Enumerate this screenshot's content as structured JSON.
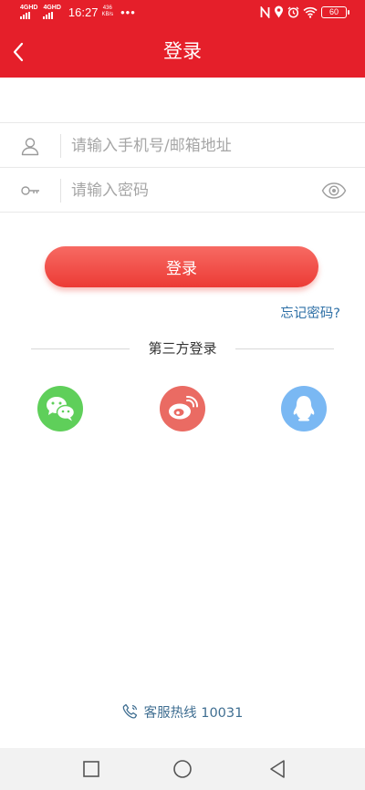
{
  "status_bar": {
    "network1": "4GHD",
    "network2": "4GHD",
    "time": "16:27",
    "speed_value": "436",
    "speed_unit": "KB/s",
    "dots": "•••",
    "battery": "60"
  },
  "header": {
    "title": "登录",
    "back_icon": "chevron-left-icon"
  },
  "form": {
    "account": {
      "icon": "user-icon",
      "placeholder": "请输入手机号/邮箱地址",
      "value": ""
    },
    "password": {
      "icon": "key-icon",
      "placeholder": "请输入密码",
      "value": "",
      "toggle_icon": "eye-icon"
    }
  },
  "login_button": "登录",
  "forgot_password": "忘记密码?",
  "third_party": {
    "label": "第三方登录",
    "providers": [
      {
        "name": "wechat",
        "icon": "wechat-icon",
        "color": "#5fcf5a"
      },
      {
        "name": "weibo",
        "icon": "weibo-icon",
        "color": "#ea6b63"
      },
      {
        "name": "qq",
        "icon": "qq-icon",
        "color": "#7ab8f3"
      }
    ]
  },
  "hotline": {
    "icon": "phone-icon",
    "text": "客服热线 10031"
  },
  "system_nav": [
    "recent-apps-icon",
    "home-icon",
    "back-icon"
  ],
  "colors": {
    "brand_red": "#e51f2a",
    "button_red": "#ec3b35",
    "link_blue": "#2d6fa6"
  }
}
